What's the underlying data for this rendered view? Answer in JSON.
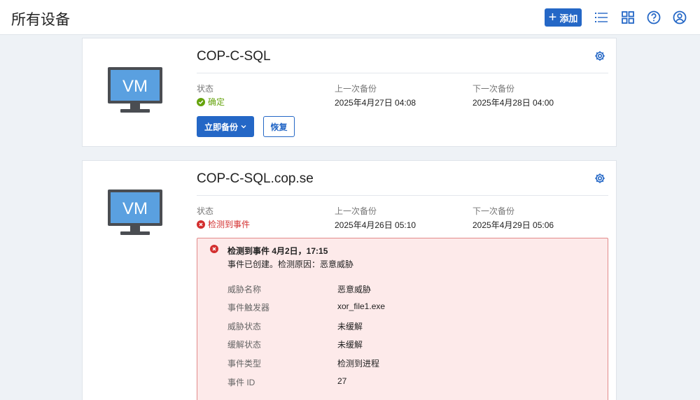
{
  "header": {
    "title": "所有设备",
    "add_label": "添加",
    "icons": [
      "list-icon",
      "grid-icon",
      "help-icon",
      "account-icon"
    ],
    "accent": "#2467c6"
  },
  "columns": {
    "status": "状态",
    "last_backup": "上一次备份",
    "next_backup": "下一次备份"
  },
  "devices": [
    {
      "name": "COP-C-SQL",
      "vm_label": "VM",
      "status": "确定",
      "status_color": "#65a30d",
      "last_backup": "2025年4月27日 04:08",
      "next_backup": "2025年4月28日 04:00",
      "backup_now": "立即备份",
      "restore": "恢复"
    },
    {
      "name": "COP-C-SQL.cop.se",
      "vm_label": "VM",
      "status": "检测到事件",
      "status_color": "#d32f2f",
      "last_backup": "2025年4月26日 05:10",
      "next_backup": "2025年4月29日 05:06",
      "alert": {
        "title": "检测到事件  4月2日，17:15",
        "subtitle": "事件已创建。检测原因：恶意威胁",
        "details": [
          {
            "label": "威胁名称",
            "value": "恶意威胁"
          },
          {
            "label": "事件触发器",
            "value": "xor_file1.exe"
          },
          {
            "label": "威胁状态",
            "value": "未缓解"
          },
          {
            "label": "缓解状态",
            "value": "未缓解"
          },
          {
            "label": "事件类型",
            "value": "检测到进程"
          },
          {
            "label": "事件 ID",
            "value": "27"
          }
        ]
      }
    }
  ]
}
